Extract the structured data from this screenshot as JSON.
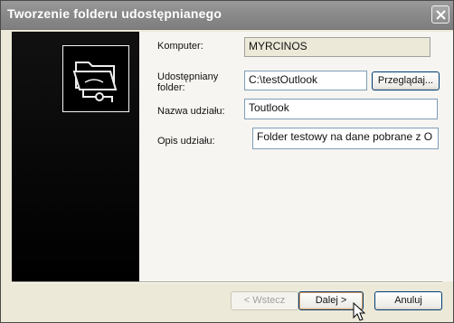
{
  "window": {
    "title": "Tworzenie folderu udostępnianego"
  },
  "form": {
    "computer_label": "Komputer:",
    "computer_value": "MYRCINOS",
    "folder_label_line1": "Udostępniany",
    "folder_label_line2": "folder:",
    "folder_value": "C:\\testOutlook",
    "browse_label": "Przeglądaj...",
    "share_name_label": "Nazwa udziału:",
    "share_name_value": "Toutlook",
    "share_desc_label": "Opis udziału:",
    "share_desc_value": "Folder testowy na dane pobrane z O"
  },
  "buttons": {
    "back": "< Wstecz",
    "next": "Dalej >",
    "cancel": "Anuluj"
  },
  "colors": {
    "titlebar": "#8a8a8a",
    "sidebar": "#000000",
    "dialog_bg": "#ece9d8"
  },
  "icons": {
    "close": "close-icon",
    "folder": "shared-folder-icon",
    "cursor": "mouse-pointer-icon"
  }
}
